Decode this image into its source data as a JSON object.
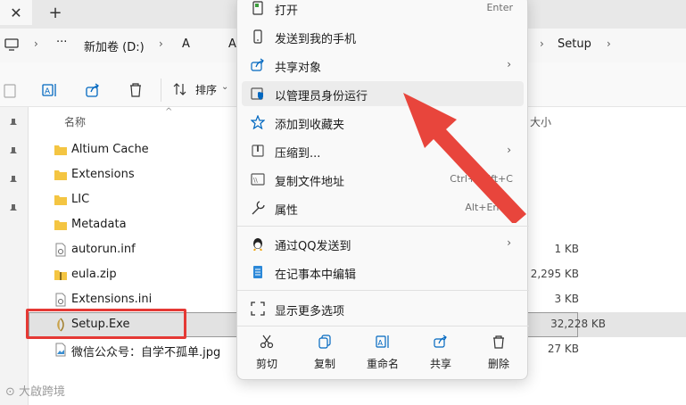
{
  "address": {
    "crumbs": [
      "新加卷 (D:)",
      "A",
      "A",
      "Setup"
    ],
    "more": "···"
  },
  "toolbar": {
    "sort_label": "排序"
  },
  "filelist": {
    "col_name": "名称",
    "col_size": "大小",
    "rows": [
      {
        "name": "Altium Cache",
        "size": "",
        "type": "folder"
      },
      {
        "name": "Extensions",
        "size": "",
        "type": "folder"
      },
      {
        "name": "LIC",
        "size": "",
        "type": "folder"
      },
      {
        "name": "Metadata",
        "size": "",
        "type": "folder"
      },
      {
        "name": "autorun.inf",
        "size": "1 KB",
        "type": "settings"
      },
      {
        "name": "eula.zip",
        "size": "2,295 KB",
        "type": "zip"
      },
      {
        "name": "Extensions.ini",
        "size": "3 KB",
        "type": "settings"
      },
      {
        "name": "Setup.Exe",
        "size": "32,228 KB",
        "type": "exe"
      },
      {
        "name": "微信公众号：自学不孤单.jpg",
        "size": "27 KB",
        "type": "image"
      }
    ]
  },
  "context_menu": {
    "items": [
      {
        "label": "打开",
        "shortcut": "Enter"
      },
      {
        "label": "发送到我的手机",
        "shortcut": ""
      },
      {
        "label": "共享对象",
        "shortcut": ""
      },
      {
        "label": "以管理员身份运行",
        "shortcut": ""
      },
      {
        "label": "添加到收藏夹",
        "shortcut": ""
      },
      {
        "label": "压缩到...",
        "shortcut": ""
      },
      {
        "label": "复制文件地址",
        "shortcut": "Ctrl+Shift+C"
      },
      {
        "label": "属性",
        "shortcut": "Alt+Enter"
      },
      {
        "label": "通过QQ发送到",
        "shortcut": ""
      },
      {
        "label": "在记事本中编辑",
        "shortcut": ""
      },
      {
        "label": "显示更多选项",
        "shortcut": ""
      }
    ],
    "quick_actions": [
      "剪切",
      "复制",
      "重命名",
      "共享",
      "删除"
    ]
  },
  "watermark": "大啟跨境",
  "colors": {
    "highlight_red": "#e53935",
    "accent_blue": "#0067c0",
    "folder_yellow": "#f4c542"
  }
}
